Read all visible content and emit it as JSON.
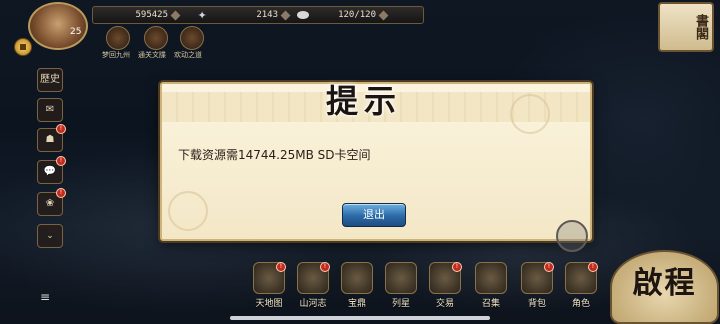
{
  "topbar": {
    "coins": "595425",
    "gems": "2143",
    "stamina": "120/120"
  },
  "player": {
    "level": "25"
  },
  "buffs": [
    {
      "label": "梦回九州"
    },
    {
      "label": "通关文牒"
    },
    {
      "label": "欢动之道"
    }
  ],
  "book": {
    "label": "書閣"
  },
  "side": {
    "history": "歷史",
    "badges": [
      "!",
      "!",
      "!"
    ]
  },
  "dialog": {
    "title": "提示",
    "message": "下载资源需14744.25MB SD卡空间",
    "exit_label": "退出"
  },
  "bottom_nav": [
    {
      "label": "天地图",
      "badge": "!"
    },
    {
      "label": "山河志",
      "badge": "!"
    },
    {
      "label": "宝鼎",
      "badge": ""
    },
    {
      "label": "列星",
      "badge": ""
    },
    {
      "label": "交易",
      "badge": "!"
    },
    {
      "label": "召集",
      "badge": ""
    },
    {
      "label": "背包",
      "badge": "!"
    },
    {
      "label": "角色",
      "badge": "!"
    }
  ],
  "start": {
    "label": "啟程"
  },
  "colors": {
    "dialog_bg": "#fbf4df",
    "exit_button": "#2b6aa8",
    "badge": "#c32b1f"
  }
}
